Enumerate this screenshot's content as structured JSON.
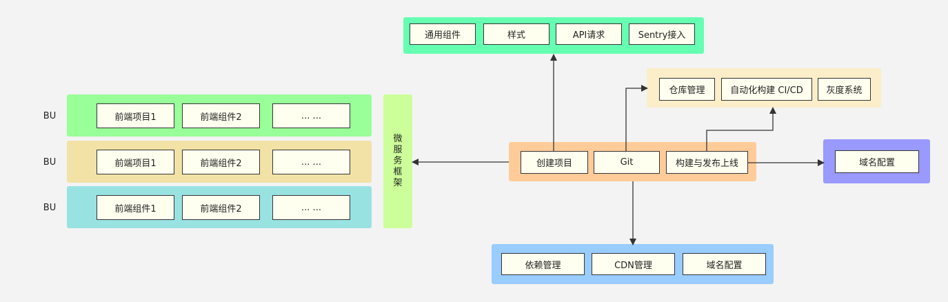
{
  "bu_rows": [
    {
      "label": "BU",
      "color": "#99ff99",
      "items": [
        "前端项目1",
        "前端组件2",
        "... ..."
      ]
    },
    {
      "label": "BU",
      "color": "#f2e2a6",
      "items": [
        "前端项目1",
        "前端组件2",
        "... ..."
      ]
    },
    {
      "label": "BU",
      "color": "#99e2e2",
      "items": [
        "前端组件1",
        "前端组件2",
        "... ..."
      ]
    }
  ],
  "micro_service": {
    "label": "微服务框架",
    "color": "#ccff99"
  },
  "top_group": {
    "color": "#66ffb2",
    "items": [
      "通用组件",
      "样式",
      "API请求",
      "Sentry接入"
    ]
  },
  "repo_group": {
    "color": "#fbeec8",
    "items": [
      "仓库管理",
      "自动化构建 CI/CD",
      "灰度系统"
    ]
  },
  "center_group": {
    "color": "#ffcc99",
    "items": [
      "创建项目",
      "Git",
      "构建与发布上线"
    ]
  },
  "domain_group": {
    "color": "#9999ff",
    "items": [
      "域名配置"
    ]
  },
  "bottom_group": {
    "color": "#99ccff",
    "items": [
      "依赖管理",
      "CDN管理",
      "域名配置"
    ]
  }
}
